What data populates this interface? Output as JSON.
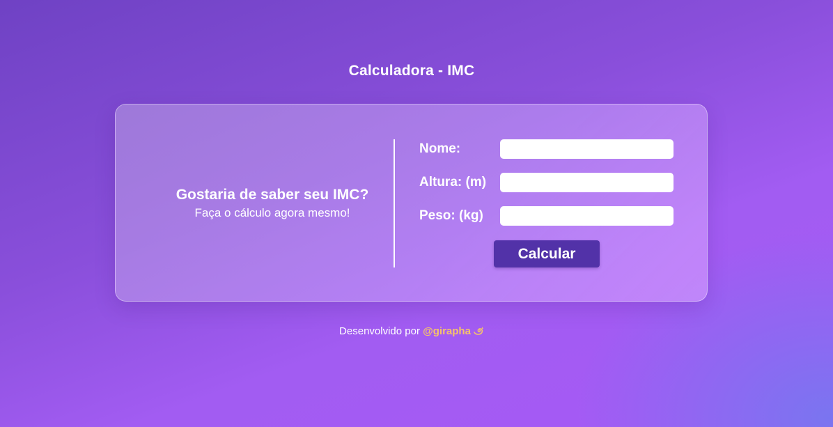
{
  "header": {
    "title": "Calculadora - IMC"
  },
  "intro": {
    "heading": "Gostaria de saber seu IMC?",
    "subheading": "Faça o cálculo agora mesmo!"
  },
  "form": {
    "fields": [
      {
        "label": "Nome:",
        "value": "",
        "placeholder": ""
      },
      {
        "label": "Altura: (m)",
        "value": "",
        "placeholder": ""
      },
      {
        "label": "Peso: (kg)",
        "value": "",
        "placeholder": ""
      }
    ],
    "submit_label": "Calcular"
  },
  "footer": {
    "prefix": "Desenvolvido por",
    "author": "@girapha",
    "icon": "dizzy-icon"
  },
  "colors": {
    "button": "#5232a8",
    "footer_link": "#f5c26b",
    "input_background": "#ffffff"
  }
}
